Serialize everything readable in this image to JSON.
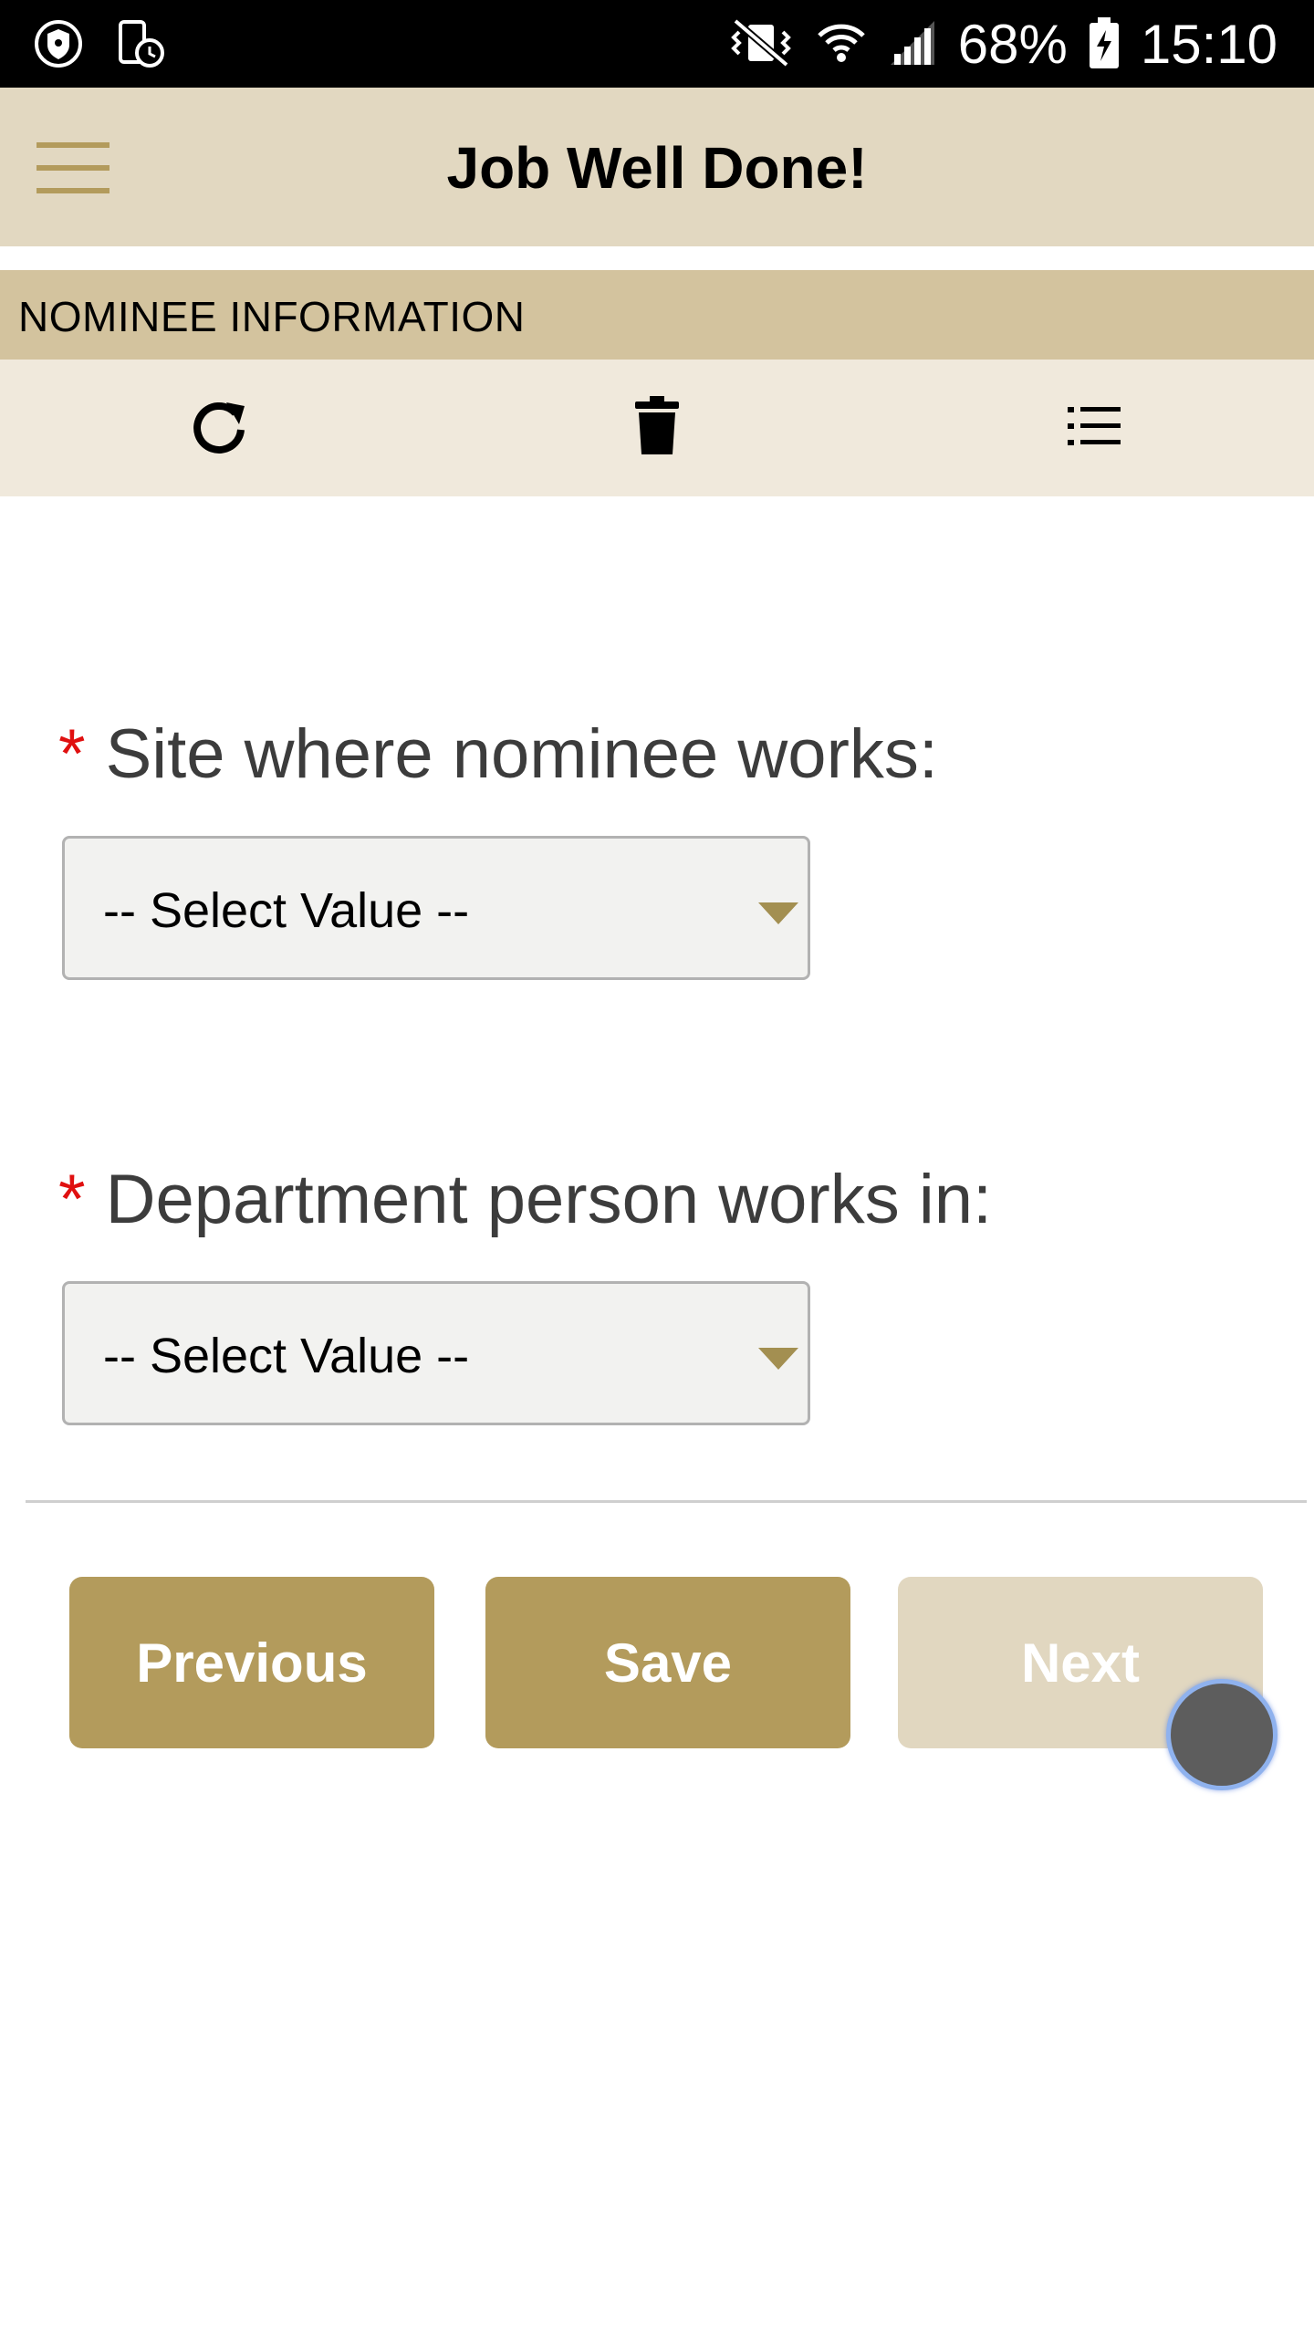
{
  "status_bar": {
    "battery_percent": "68%",
    "time": "15:10",
    "icons": [
      "shield-icon",
      "device-schedule-icon",
      "vibrate-mute-icon",
      "wifi-icon",
      "signal-icon",
      "battery-charging-icon"
    ]
  },
  "header": {
    "title": "Job Well Done!",
    "menu_icon": "hamburger-menu-icon"
  },
  "section": {
    "title": "NOMINEE INFORMATION",
    "toolbar": [
      "refresh-icon",
      "trash-icon",
      "list-icon"
    ]
  },
  "form": {
    "fields": [
      {
        "label": "Site where nominee works:",
        "required_mark": "*",
        "value": "-- Select Value --"
      },
      {
        "label": "Department person works in:",
        "required_mark": "*",
        "value": "-- Select Value --"
      }
    ]
  },
  "actions": {
    "previous_label": "Previous",
    "save_label": "Save",
    "next_label": "Next"
  },
  "colors": {
    "header_bg": "#e2d8c1",
    "section_bg": "#d3c39e",
    "toolbar_bg": "#f0e9dc",
    "accent": "#b39b5c",
    "disabled": "#e1d7c0",
    "required": "#e01010"
  }
}
